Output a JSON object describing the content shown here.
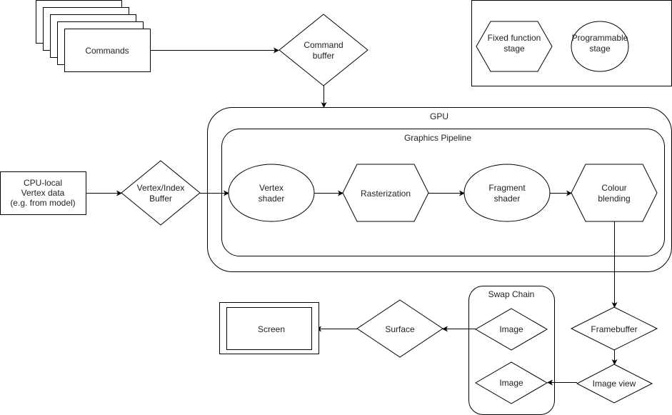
{
  "legend": {
    "fixed_function": [
      "Fixed function",
      "stage"
    ],
    "programmable": [
      "Programmable",
      "stage"
    ]
  },
  "nodes": {
    "commands": "Commands",
    "command_buffer": [
      "Command",
      "buffer"
    ],
    "gpu": "GPU",
    "graphics_pipeline": "Graphics Pipeline",
    "cpu_vertex_data": [
      "CPU-local",
      "Vertex data",
      "(e.g. from model)"
    ],
    "vertex_index_buffer": [
      "Vertex/Index",
      "Buffer"
    ],
    "vertex_shader": [
      "Vertex",
      "shader"
    ],
    "rasterization": "Rasterization",
    "fragment_shader": [
      "Fragment",
      "shader"
    ],
    "colour_blending": [
      "Colour",
      "blending"
    ],
    "framebuffer": "Framebuffer",
    "image_view": "Image view",
    "swap_chain": "Swap Chain",
    "image_1": "Image",
    "image_2": "Image",
    "surface": "Surface",
    "screen": "Screen"
  }
}
